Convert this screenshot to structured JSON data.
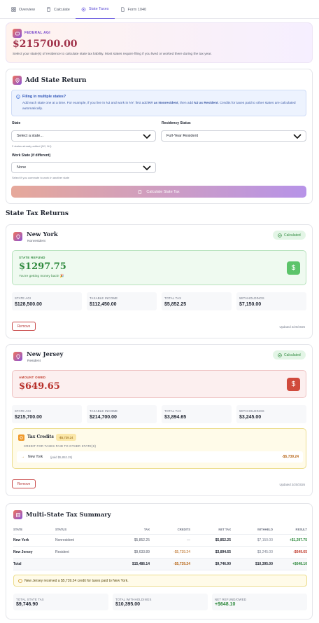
{
  "tabs": [
    {
      "label": "Overview",
      "icon": "grid-icon"
    },
    {
      "label": "Calculate",
      "icon": "calculator-icon"
    },
    {
      "label": "State Taxes",
      "icon": "pin-icon",
      "active": true
    },
    {
      "label": "Form 1040",
      "icon": "document-icon"
    }
  ],
  "agi": {
    "label": "FEDERAL AGI",
    "value": "$215700.00",
    "description": "Select your state(s) of residence to calculate state tax liability. Most states require filing if you lived or worked there during the tax year."
  },
  "add_state": {
    "title": "Add State Return",
    "info_title": "Filing in multiple states?",
    "info_text_a": "Add each state one at a time. For example, if you live in NJ and work in NY: first add ",
    "info_bold_1": "NY as Nonresident",
    "info_text_b": ", then add ",
    "info_bold_2": "NJ as Resident",
    "info_text_c": ". Credits for taxes paid to other states are calculated automatically.",
    "state_label": "State",
    "state_value": "Select a state...",
    "state_help": "2 states already added (NY, NJ)",
    "residency_label": "Residency Status",
    "residency_value": "Full-Year Resident",
    "work_label": "Work State (if different)",
    "work_value": "None",
    "work_help": "Select if you commute to work in another state",
    "button_label": "Calculate State Tax"
  },
  "returns_title": "State Tax Returns",
  "ny": {
    "name": "New York",
    "status": "Nonresident",
    "badge": "Calculated",
    "result_label": "STATE REFUND",
    "result_value": "$1297.75",
    "result_note": "You're getting money back! 🎉",
    "result_icon": "$",
    "stats": [
      {
        "label": "STATE AGI",
        "value": "$128,500.00"
      },
      {
        "label": "TAXABLE INCOME",
        "value": "$112,450.00"
      },
      {
        "label": "TOTAL TAX",
        "value": "$5,852.25"
      },
      {
        "label": "WITHHOLDINGS",
        "value": "$7,150.00"
      }
    ],
    "remove": "Remove",
    "updated": "Updated 2/20/2026"
  },
  "nj": {
    "name": "New Jersey",
    "status": "Resident",
    "badge": "Calculated",
    "result_label": "AMOUNT OWED",
    "result_value": "$649.65",
    "result_icon": "$",
    "stats": [
      {
        "label": "STATE AGI",
        "value": "$215,700.00"
      },
      {
        "label": "TAXABLE INCOME",
        "value": "$214,700.00"
      },
      {
        "label": "TOTAL TAX",
        "value": "$3,894.65"
      },
      {
        "label": "WITHHOLDINGS",
        "value": "$3,245.00"
      }
    ],
    "credits": {
      "title": "Tax Credits",
      "chip": "-$5,739.24",
      "sub": "CREDIT FOR TAXES PAID TO OTHER STATE(S)",
      "item_state": "New York",
      "item_paid": "(paid $5,852.25)",
      "item_value": "-$5,739.24"
    },
    "remove": "Remove",
    "updated": "Updated 2/20/2026"
  },
  "summary": {
    "title": "Multi-State Tax Summary",
    "headers": [
      "STATE",
      "STATUS",
      "TAX",
      "CREDITS",
      "NET TAX",
      "WITHHELD",
      "RESULT"
    ],
    "rows": [
      {
        "state": "New York",
        "status": "Nonresident",
        "tax": "$5,852.25",
        "credits": "—",
        "net": "$5,852.25",
        "withheld": "$7,150.00",
        "result": "+$1,297.75"
      },
      {
        "state": "New Jersey",
        "status": "Resident",
        "tax": "$9,633.89",
        "credits": "-$5,739.24",
        "net": "$3,894.65",
        "withheld": "$3,245.00",
        "result": "-$649.65"
      },
      {
        "state": "Total",
        "status": "",
        "tax": "$15,486.14",
        "credits": "-$5,739.24",
        "net": "$9,746.90",
        "withheld": "$10,395.00",
        "result": "+$648.10"
      }
    ],
    "note": "New Jersey received a $5,739.24 credit for taxes paid to New York.",
    "totals": [
      {
        "label": "TOTAL STATE TAX",
        "value": "$9,746.90"
      },
      {
        "label": "TOTAL WITHHOLDINGS",
        "value": "$10,395.00"
      },
      {
        "label": "NET REFUND/OWED",
        "value": "+$648.10"
      }
    ]
  },
  "colors": {
    "accent": "#6a5ae0",
    "green": "#2f8a3e",
    "red": "#c0392b",
    "orange": "#d97a1a"
  }
}
